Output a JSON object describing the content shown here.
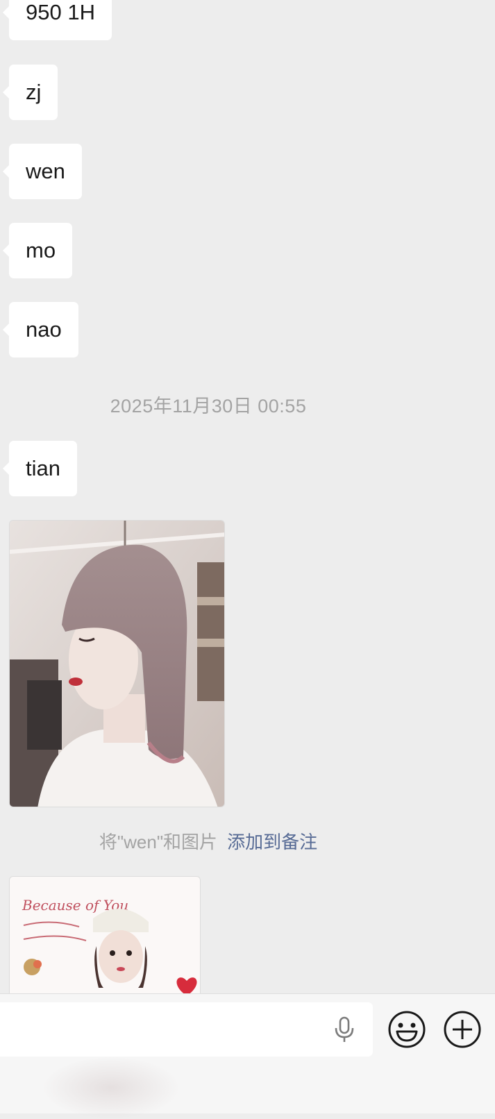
{
  "messages": [
    {
      "text": "950 1H"
    },
    {
      "text": "zj"
    },
    {
      "text": "wen"
    },
    {
      "text": "mo"
    },
    {
      "text": "nao"
    }
  ],
  "timestamp": "2025年11月30日 00:55",
  "messages_after": [
    {
      "text": "tian"
    }
  ],
  "hint": {
    "text": "将\"wen\"和图片",
    "link": "添加到备注"
  },
  "images": [
    {
      "description_icon": "photo-portrait-bob-hair"
    },
    {
      "description_icon": "photo-sticker-card"
    }
  ],
  "sticker_text": "Because of You",
  "input": {
    "value": "",
    "mic_icon": "microphone-icon",
    "emoji_icon": "emoji-icon",
    "plus_icon": "plus-icon"
  },
  "colors": {
    "background": "#ededed",
    "bubble": "#ffffff",
    "link": "#576b95",
    "muted_text": "#a3a3a3",
    "icon": "#191919"
  }
}
